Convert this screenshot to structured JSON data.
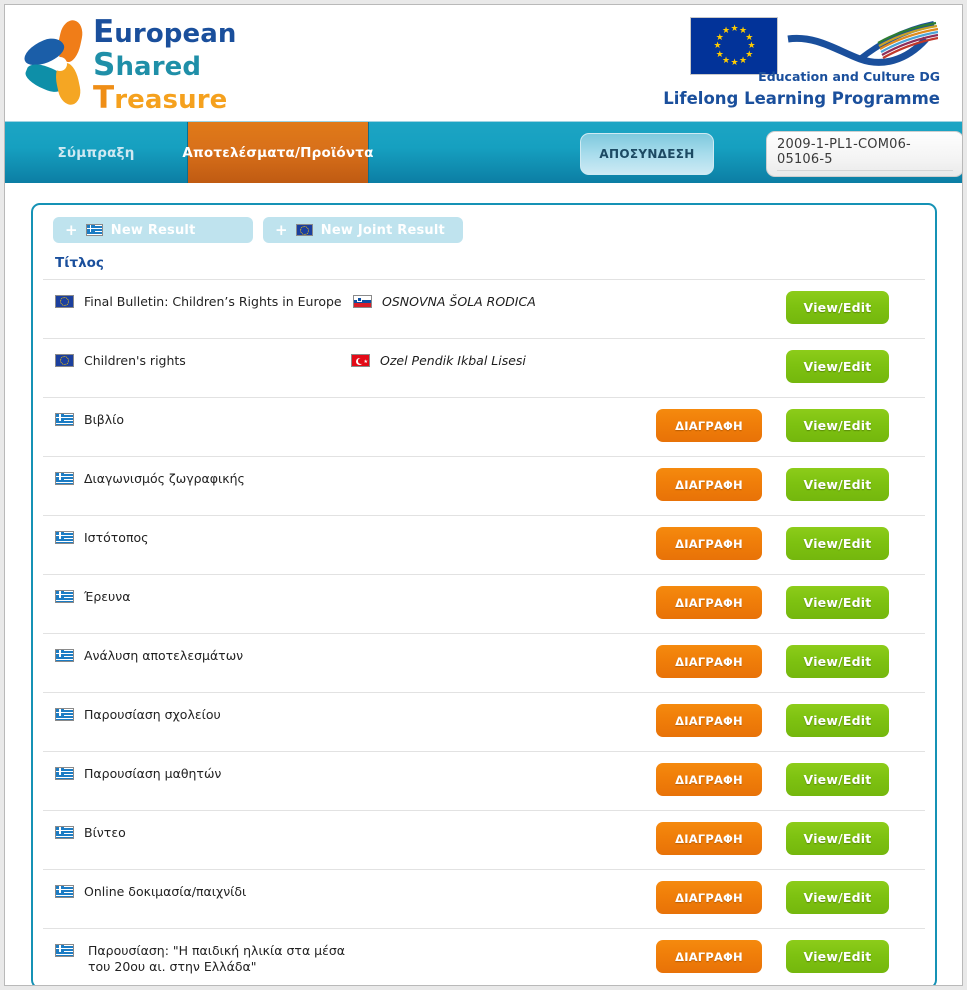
{
  "brand": {
    "logo_lines": [
      {
        "cap": "E",
        "rest": "uropean"
      },
      {
        "cap": "S",
        "rest": "hared"
      },
      {
        "cap": "T",
        "rest": "reasure"
      }
    ],
    "llp_eu_flag": "eu-flag-icon",
    "ec_dg_label": "Education and Culture DG",
    "llp_label": "Lifelong Learning Programme"
  },
  "nav": {
    "tabs": [
      {
        "label": "Σύμπραξη",
        "active": false
      },
      {
        "label": "Αποτελέσματα/Προϊόντα",
        "active": true
      }
    ],
    "logout_label": "ΑΠΟΣΥΝΔΕΣΗ",
    "project_id": "2009-1-PL1-COM06-05106-5"
  },
  "toolbar": {
    "new_result_label": "New Result",
    "new_joint_result_label": "New Joint Result",
    "plus_glyph": "+"
  },
  "table": {
    "column_header": "Τίτλος",
    "delete_label": "ΔΙΑΓΡΑΦΗ",
    "view_edit_label": "View/Edit",
    "rows": [
      {
        "flag": "eu",
        "title": "Final Bulletin: Children’s Rights in Europe",
        "partner_flag": "si",
        "partner": "OSNOVNA ŠOLA RODICA",
        "has_delete": false,
        "has_view": true
      },
      {
        "flag": "eu",
        "title": "Children's rights",
        "partner_flag": "tr",
        "partner": "Ozel Pendik Ikbal Lisesi",
        "has_delete": false,
        "has_view": true
      },
      {
        "flag": "gr",
        "title": "Βιβλίο",
        "partner_flag": "",
        "partner": "",
        "has_delete": true,
        "has_view": true
      },
      {
        "flag": "gr",
        "title": "Διαγωνισμός ζωγραφικής",
        "partner_flag": "",
        "partner": "",
        "has_delete": true,
        "has_view": true
      },
      {
        "flag": "gr",
        "title": "Ιστότοπος",
        "partner_flag": "",
        "partner": "",
        "has_delete": true,
        "has_view": true
      },
      {
        "flag": "gr",
        "title": "Έρευνα",
        "partner_flag": "",
        "partner": "",
        "has_delete": true,
        "has_view": true
      },
      {
        "flag": "gr",
        "title": "Ανάλυση αποτελεσμάτων",
        "partner_flag": "",
        "partner": "",
        "has_delete": true,
        "has_view": true
      },
      {
        "flag": "gr",
        "title": "Παρουσίαση σχολείου",
        "partner_flag": "",
        "partner": "",
        "has_delete": true,
        "has_view": true
      },
      {
        "flag": "gr",
        "title": "Παρουσίαση μαθητών",
        "partner_flag": "",
        "partner": "",
        "has_delete": true,
        "has_view": true
      },
      {
        "flag": "gr",
        "title": "Βίντεο",
        "partner_flag": "",
        "partner": "",
        "has_delete": true,
        "has_view": true
      },
      {
        "flag": "gr",
        "title": "Online δοκιμασία/παιχνίδι",
        "partner_flag": "",
        "partner": "",
        "has_delete": true,
        "has_view": true
      },
      {
        "flag": "gr",
        "title": "Παρουσίαση: \"Η παιδική ηλικία στα μέσα\nτου 20ου αι. στην Ελλάδα\"",
        "partner_flag": "",
        "partner": "",
        "has_delete": true,
        "has_view": true,
        "two_line": true
      }
    ]
  },
  "colors": {
    "teal": "#1592b5",
    "orange_tab": "#d8701a",
    "delete_orange": "#f07e09",
    "view_green": "#7ec211",
    "brand_blue": "#1a4f9c",
    "light_blue_btn": "#bfe3ee"
  }
}
